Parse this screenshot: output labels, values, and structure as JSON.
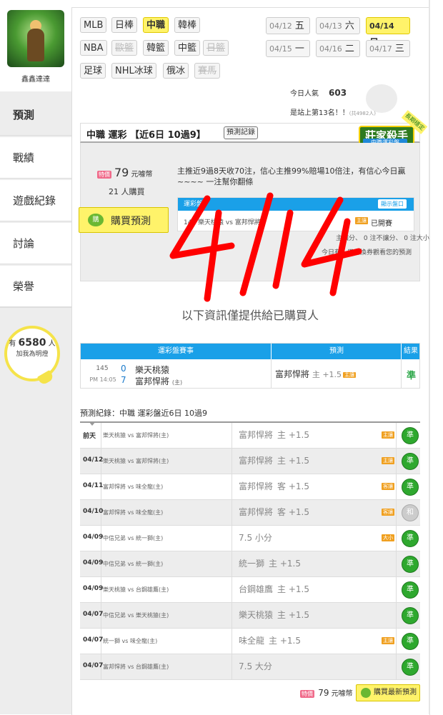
{
  "sidebar": {
    "username": "鑫鑫達達",
    "nav": [
      {
        "label": "預測",
        "active": true
      },
      {
        "label": "戰績"
      },
      {
        "label": "遊戲紀錄"
      },
      {
        "label": "討論"
      },
      {
        "label": "榮譽"
      }
    ],
    "fans": {
      "prefix": "有",
      "count": "6580",
      "unit": "人",
      "cta": "加我為明燈"
    }
  },
  "leagues": [
    {
      "label": "MLB"
    },
    {
      "label": "日棒"
    },
    {
      "label": "中職",
      "active": true
    },
    {
      "label": "韓棒"
    },
    {
      "label": "NBA"
    },
    {
      "label": "歐籃",
      "disabled": true
    },
    {
      "label": "韓籃"
    },
    {
      "label": "中籃"
    },
    {
      "label": "日籃",
      "disabled": true
    },
    {
      "label": "足球"
    },
    {
      "label": "NHL冰球"
    },
    {
      "label": "俄冰"
    },
    {
      "label": "賽馬",
      "disabled": true
    }
  ],
  "dates": [
    {
      "date": "04/12",
      "day": "五"
    },
    {
      "date": "04/13",
      "day": "六"
    },
    {
      "date": "04/14",
      "day": "日",
      "active": true
    },
    {
      "date": "04/15",
      "day": "一"
    },
    {
      "date": "04/16",
      "day": "二"
    },
    {
      "date": "04/17",
      "day": "三"
    }
  ],
  "stats": {
    "popular_label": "今日人氣",
    "popular_value": "603",
    "rank_text": "是站上第13名！！",
    "rank_small": "(共4982人)"
  },
  "panel": {
    "title": "中職 運彩 【近6日 10過9】",
    "record_button": "預測記錄",
    "badge_main": "莊家殺手",
    "badge_sub": "中職運彩盤",
    "badge_ribbon": "長期穩定",
    "price_tag": "特價",
    "price_value": "79",
    "price_unit": "元噱幣",
    "buyers": "21 人購買",
    "buy_button": "購買預測",
    "buy_icon": "購",
    "description": "主推近9過8天收70注，信心主推99%賠場10倍注，有信心今日贏~~~~ 一注幫你翻條",
    "mini_header": "運彩盤",
    "mini_button": "顯示盤口",
    "mini_row": "145    樂天桃猿  vs  富邦悍將",
    "mini_handicap": "主讓",
    "mini_status": "已開賽",
    "summary": "主讓分、 0 注不讓分、 0 注大小",
    "voucher": "今日有人用兌換券觀看您的預測"
  },
  "info_message": "以下資訊僅提供給已購買人",
  "result_table": {
    "headers": [
      "運彩盤賽事",
      "預測",
      "結果"
    ],
    "game_no": "145",
    "time": "PM 14:05",
    "team1": {
      "score": "0",
      "name": "樂天桃猿"
    },
    "team2": {
      "score": "7",
      "name": "富邦悍將",
      "home": "(主)"
    },
    "pick": "富邦悍將",
    "pick_spread": "主 +1.5",
    "pick_tag": "主讓",
    "result": "準"
  },
  "records_title": "預測紀錄：中職 運彩盤近6日 10過9",
  "records": [
    {
      "date": "前天",
      "match": "樂天桃猿 vs 富邦悍將(主)",
      "pick": "富邦悍將",
      "spread": "主 +1.5",
      "tag": "主讓",
      "result": "準"
    },
    {
      "date": "04/12",
      "match": "樂天桃猿 vs 富邦悍將(主)",
      "pick": "富邦悍將",
      "spread": "主 +1.5",
      "tag": "主讓",
      "result": "準"
    },
    {
      "date": "04/11",
      "match": "富邦悍將 vs 味全龍(主)",
      "pick": "富邦悍將",
      "spread": "客 +1.5",
      "tag": "客讓",
      "result": "準"
    },
    {
      "date": "04/10",
      "match": "富邦悍將 vs 味全龍(主)",
      "pick": "富邦悍將",
      "spread": "客 +1.5",
      "tag": "客讓",
      "result": "和"
    },
    {
      "date": "04/09",
      "match": "中信兄弟 vs 統一獅(主)",
      "pick": "7.5 小分",
      "spread": "",
      "tag": "大小",
      "result": "準"
    },
    {
      "date": "04/09",
      "match": "中信兄弟 vs 統一獅(主)",
      "pick": "統一獅",
      "spread": "主 +1.5",
      "tag": "",
      "result": "準"
    },
    {
      "date": "04/09",
      "match": "樂天桃猿 vs 台鋼雄鷹(主)",
      "pick": "台鋼雄鷹",
      "spread": "主 +1.5",
      "tag": "",
      "result": "準"
    },
    {
      "date": "04/07",
      "match": "中信兄弟 vs 樂天桃猿(主)",
      "pick": "樂天桃猿",
      "spread": "主 +1.5",
      "tag": "",
      "result": "準"
    },
    {
      "date": "04/07",
      "match": "統一獅 vs 味全龍(主)",
      "pick": "味全龍",
      "spread": "主 +1.5",
      "tag": "主讓",
      "result": "準"
    },
    {
      "date": "04/07",
      "match": "富邦悍將 vs 台鋼雄鷹(主)",
      "pick": "7.5 大分",
      "spread": "",
      "tag": "",
      "result": "準"
    }
  ],
  "bottom": {
    "price_tag": "特價",
    "price_value": "79",
    "price_unit": "元噱幣",
    "buy_button": "購買最新預測"
  },
  "overlay_text": "4/14",
  "colors": {
    "accent_yellow": "#fff36a",
    "header_blue": "#1aa0e8",
    "win_green": "#2ea82e",
    "handicap_orange": "#f0a020",
    "scribble_red": "#ff0000"
  }
}
